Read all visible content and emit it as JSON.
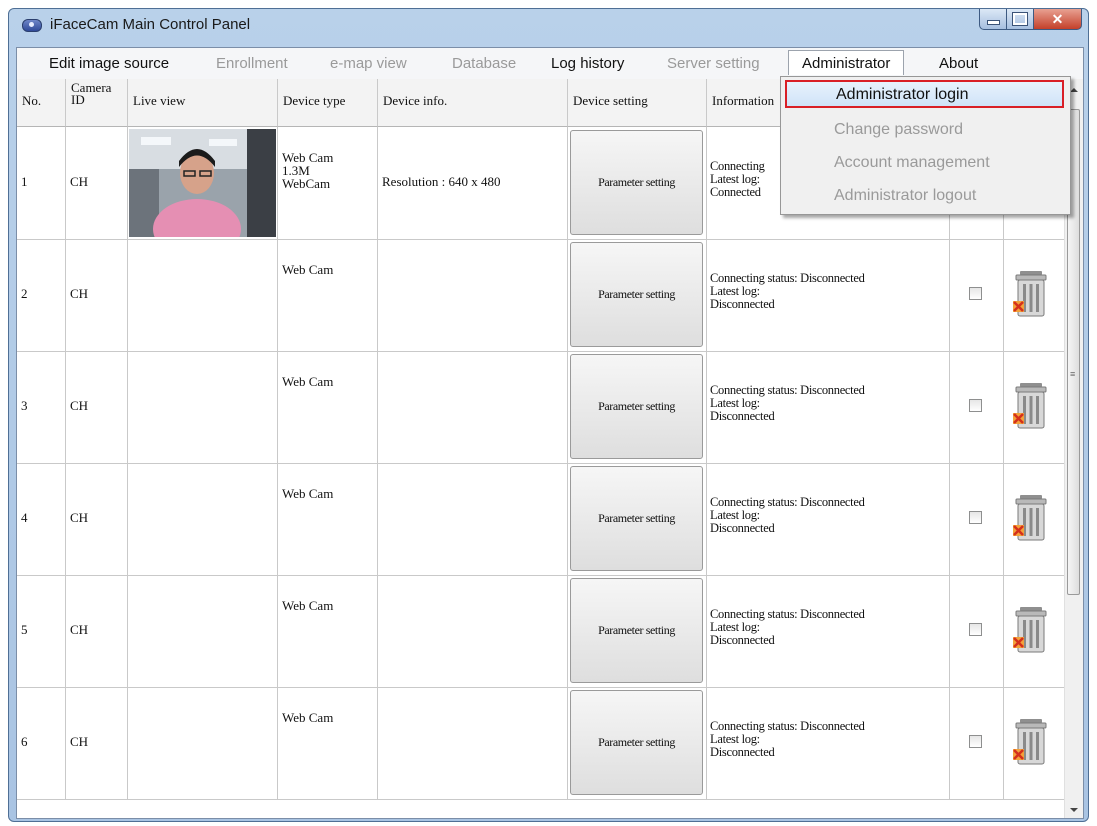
{
  "window": {
    "title": "iFaceCam Main Control Panel"
  },
  "menu": [
    {
      "label": "Edit image source",
      "enabled": true
    },
    {
      "label": "Enrollment",
      "enabled": false
    },
    {
      "label": "e-map view",
      "enabled": false
    },
    {
      "label": "Database",
      "enabled": false
    },
    {
      "label": "Log history",
      "enabled": true
    },
    {
      "label": "Server setting",
      "enabled": false
    },
    {
      "label": "Administrator",
      "enabled": true,
      "open": true
    },
    {
      "label": "About",
      "enabled": true
    }
  ],
  "dropdown": [
    {
      "label": "Administrator login",
      "enabled": true,
      "highlighted": true
    },
    {
      "label": "Change password",
      "enabled": false
    },
    {
      "label": "Account management",
      "enabled": false
    },
    {
      "label": "Administrator logout",
      "enabled": false
    }
  ],
  "columns": {
    "no": "No.",
    "camera_id_1": "Camera",
    "camera_id_2": "ID",
    "live_view": "Live view",
    "device_type": "Device type",
    "device_info": "Device info.",
    "device_setting": "Device setting",
    "information": "Information"
  },
  "rows": [
    {
      "no": "1",
      "camera_id": "CH",
      "has_live": true,
      "type_lines": [
        "Web Cam",
        "1.3M",
        "WebCam"
      ],
      "info": "Resolution : 640 x 480",
      "button": "Parameter setting",
      "status_lines": [
        "Connecting",
        "Latest log:",
        "Connected"
      ],
      "show_actions": false
    },
    {
      "no": "2",
      "camera_id": "CH",
      "has_live": false,
      "type_lines": [
        "Web Cam"
      ],
      "info": "",
      "button": "Parameter setting",
      "status_lines": [
        "Connecting status: Disconnected",
        "Latest log:",
        "Disconnected"
      ],
      "show_actions": true
    },
    {
      "no": "3",
      "camera_id": "CH",
      "has_live": false,
      "type_lines": [
        "Web Cam"
      ],
      "info": "",
      "button": "Parameter setting",
      "status_lines": [
        "Connecting status: Disconnected",
        "Latest log:",
        "Disconnected"
      ],
      "show_actions": true
    },
    {
      "no": "4",
      "camera_id": "CH",
      "has_live": false,
      "type_lines": [
        "Web Cam"
      ],
      "info": "",
      "button": "Parameter setting",
      "status_lines": [
        "Connecting status: Disconnected",
        "Latest log:",
        "Disconnected"
      ],
      "show_actions": true
    },
    {
      "no": "5",
      "camera_id": "CH",
      "has_live": false,
      "type_lines": [
        "Web Cam"
      ],
      "info": "",
      "button": "Parameter setting",
      "status_lines": [
        "Connecting status: Disconnected",
        "Latest log:",
        "Disconnected"
      ],
      "show_actions": true
    },
    {
      "no": "6",
      "camera_id": "CH",
      "has_live": false,
      "type_lines": [
        "Web Cam"
      ],
      "info": "",
      "button": "Parameter setting",
      "status_lines": [
        "Connecting status: Disconnected",
        "Latest log:",
        "Disconnected"
      ],
      "show_actions": true
    }
  ],
  "icons": {
    "app": "webcam-icon",
    "row_checkbox": "checkbox-icon",
    "row_delete": "trash-delete-icon"
  },
  "colors": {
    "highlight_border": "#d91f26",
    "close_button": "#c4402a"
  }
}
